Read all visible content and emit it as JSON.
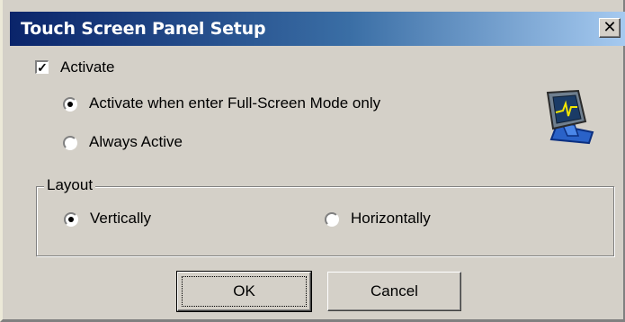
{
  "window": {
    "title": "Touch Screen Panel Setup",
    "close_glyph": "✕"
  },
  "activate": {
    "label": "Activate",
    "checked": true,
    "options": [
      {
        "label": "Activate when enter Full-Screen Mode only",
        "selected": true
      },
      {
        "label": "Always Active",
        "selected": false
      }
    ]
  },
  "layout": {
    "legend": "Layout",
    "options": [
      {
        "label": "Vertically",
        "selected": true
      },
      {
        "label": "Horizontally",
        "selected": false
      }
    ]
  },
  "buttons": {
    "ok": "OK",
    "cancel": "Cancel"
  },
  "icons": {
    "monitor": "touch-screen-monitor-icon"
  },
  "colors": {
    "titlebar_start": "#0a246a",
    "titlebar_end": "#a6caf0",
    "face": "#d4d0c8"
  }
}
